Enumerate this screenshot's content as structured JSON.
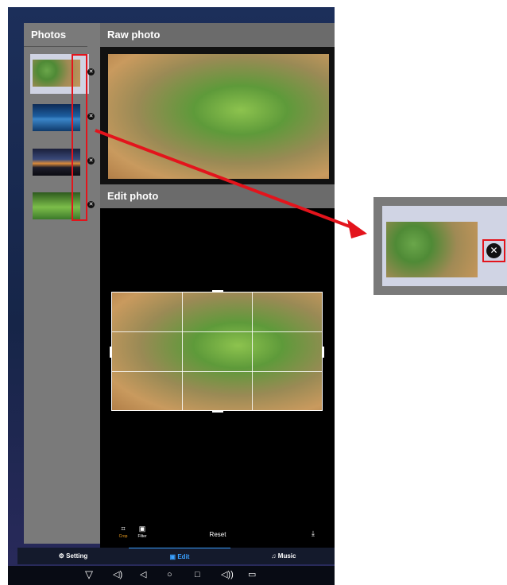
{
  "sidebar": {
    "title": "Photos",
    "items": [
      {
        "image": "green-leaves",
        "delete_icon": "close-circle-icon"
      },
      {
        "image": "ocean-sunset",
        "delete_icon": "close-circle-icon"
      },
      {
        "image": "dusk-lake",
        "delete_icon": "close-circle-icon"
      },
      {
        "image": "green-field",
        "delete_icon": "close-circle-icon"
      }
    ]
  },
  "raw": {
    "title": "Raw photo"
  },
  "edit": {
    "title": "Edit photo"
  },
  "tools": {
    "crop_label": "Crop",
    "filter_label": "Filter",
    "reset_label": "Reset",
    "crop_icon": "crop-icon",
    "filter_icon": "filter-icon",
    "save_icon": "download-icon"
  },
  "tabs": [
    {
      "label": "Setting",
      "icon": "gear-icon",
      "active": false
    },
    {
      "label": "Edit",
      "icon": "image-icon",
      "active": true
    },
    {
      "label": "Music",
      "icon": "music-icon",
      "active": false
    }
  ],
  "colors": {
    "accent": "#3aa0ff",
    "highlight": "#e3141c",
    "panel": "#6b6b6b"
  }
}
